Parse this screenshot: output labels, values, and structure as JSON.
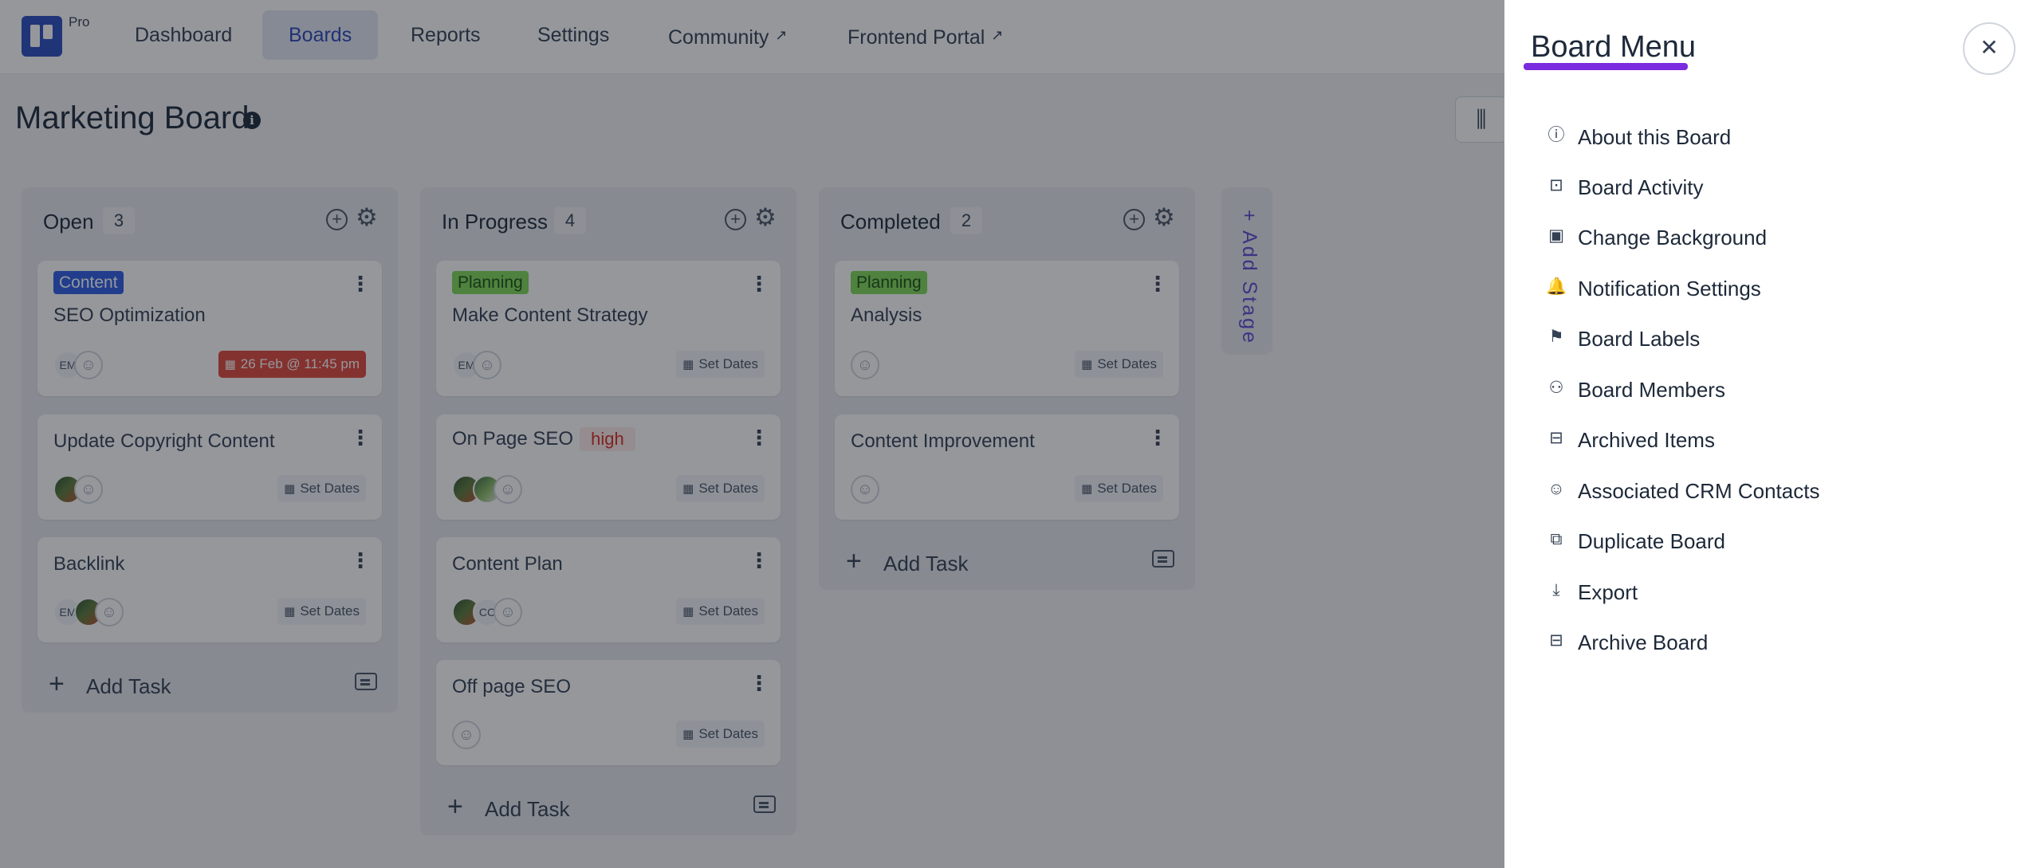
{
  "nav": {
    "badge": "Pro",
    "items": [
      {
        "label": "Dashboard",
        "external": false
      },
      {
        "label": "Boards",
        "external": false,
        "active": true
      },
      {
        "label": "Reports",
        "external": false
      },
      {
        "label": "Settings",
        "external": false
      },
      {
        "label": "Community",
        "external": true
      },
      {
        "label": "Frontend Portal",
        "external": true
      }
    ],
    "external_icon": "↗"
  },
  "board": {
    "title": "Marketing Board"
  },
  "columns": [
    {
      "title": "Open",
      "count": "3",
      "cards": [
        {
          "tag": "Content",
          "title": "SEO Optimization",
          "avatars": [
            "EM"
          ],
          "date": "26 Feb @ 11:45 pm",
          "overdue": true
        },
        {
          "title": "Update Copyright Content",
          "date": "Set Dates"
        },
        {
          "title": "Backlink",
          "avatars": [
            "EM"
          ],
          "date": "Set Dates"
        }
      ],
      "add_task": "Add Task"
    },
    {
      "title": "In Progress",
      "count": "4",
      "cards": [
        {
          "tag": "Planning",
          "title": "Make Content Strategy",
          "avatars": [
            "EM"
          ],
          "date": "Set Dates"
        },
        {
          "title": "On Page SEO",
          "priority": "high",
          "date": "Set Dates"
        },
        {
          "title": "Content Plan",
          "avatars": [
            "CC"
          ],
          "date": "Set Dates"
        },
        {
          "title": "Off page SEO",
          "date": "Set Dates"
        }
      ],
      "add_task": "Add Task"
    },
    {
      "title": "Completed",
      "count": "2",
      "cards": [
        {
          "tag": "Planning",
          "title": "Analysis",
          "date": "Set Dates"
        },
        {
          "title": "Content Improvement",
          "date": "Set Dates"
        }
      ],
      "add_task": "Add Task"
    }
  ],
  "add_stage": {
    "label": "+ Add Stage"
  },
  "drawer": {
    "title": "Board Menu",
    "close_icon": "close-icon",
    "items": [
      {
        "label": "About this Board",
        "icon": "info-icon",
        "glyph": "ⓘ"
      },
      {
        "label": "Board Activity",
        "icon": "activity-icon",
        "glyph": "⊡"
      },
      {
        "label": "Change Background",
        "icon": "image-icon",
        "glyph": "▣"
      },
      {
        "label": "Notification Settings",
        "icon": "bell-icon",
        "glyph": "🔔"
      },
      {
        "label": "Board Labels",
        "icon": "flag-icon",
        "glyph": "⚑"
      },
      {
        "label": "Board Members",
        "icon": "users-icon",
        "glyph": "⚇"
      },
      {
        "label": "Archived Items",
        "icon": "archive-box-icon",
        "glyph": "⊟"
      },
      {
        "label": "Associated CRM Contacts",
        "icon": "contact-icon",
        "glyph": "☺"
      },
      {
        "label": "Duplicate Board",
        "icon": "copy-icon",
        "glyph": "⧉"
      },
      {
        "label": "Export",
        "icon": "download-icon",
        "glyph": "⤓"
      },
      {
        "label": "Archive Board",
        "icon": "archive-icon",
        "glyph": "⊟"
      }
    ]
  },
  "colors": {
    "accent": "#2b46b8",
    "drawer_underline": "#7a2be0",
    "tag_content": "#2d5be3",
    "tag_planning": "#7ed957",
    "overdue": "#e0473b",
    "add_stage_text": "#5b4bd6"
  }
}
